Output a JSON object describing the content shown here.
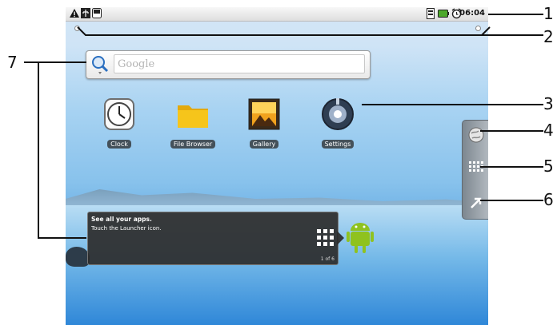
{
  "status_bar": {
    "time": "06:04",
    "left_icons": [
      "warning-icon",
      "usb-icon",
      "sd-card-icon"
    ],
    "right_icons": [
      "sim-icon",
      "battery-icon",
      "alarm-icon"
    ]
  },
  "search": {
    "placeholder": "Google"
  },
  "apps": [
    {
      "label": "Clock"
    },
    {
      "label": "File Browser"
    },
    {
      "label": "Gallery"
    },
    {
      "label": "Settings"
    }
  ],
  "tip": {
    "title": "See all your apps.",
    "body": "Touch the Launcher icon.",
    "pager": "1 of 6"
  },
  "side_panel": [
    "browser-icon",
    "launcher-grid-icon",
    "shortcut-arrow-icon"
  ],
  "callouts": [
    "1",
    "2",
    "3",
    "4",
    "5",
    "6",
    "7"
  ],
  "colors": {
    "accent_green": "#8fc21f",
    "folder_yellow": "#f4c21a"
  }
}
